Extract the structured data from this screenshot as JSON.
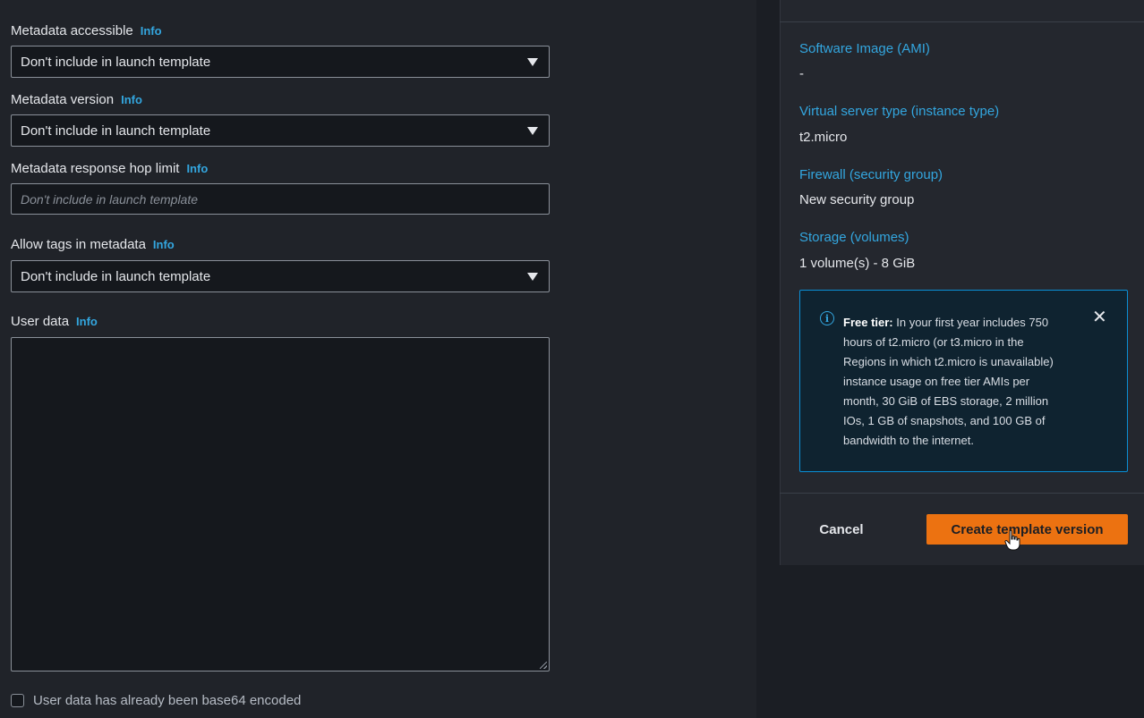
{
  "form": {
    "metadata_accessible": {
      "label": "Metadata accessible",
      "info": "Info",
      "value": "Don't include in launch template"
    },
    "metadata_version": {
      "label": "Metadata version",
      "info": "Info",
      "value": "Don't include in launch template"
    },
    "hop_limit": {
      "label": "Metadata response hop limit",
      "info": "Info",
      "placeholder": "Don't include in launch template"
    },
    "allow_tags": {
      "label": "Allow tags in metadata",
      "info": "Info",
      "value": "Don't include in launch template"
    },
    "user_data": {
      "label": "User data",
      "info": "Info",
      "value": ""
    },
    "base64_checkbox": {
      "label": "User data has already been base64 encoded",
      "checked": false
    }
  },
  "summary": {
    "ami": {
      "label": "Software Image (AMI)",
      "value": "-"
    },
    "instance_type": {
      "label": "Virtual server type (instance type)",
      "value": "t2.micro"
    },
    "firewall": {
      "label": "Firewall (security group)",
      "value": "New security group"
    },
    "storage": {
      "label": "Storage (volumes)",
      "value": "1 volume(s) - 8 GiB"
    },
    "free_tier": {
      "title": "Free tier:",
      "lines": [
        " In your first year includes 750",
        "hours of t2.micro (or t3.micro in the",
        "Regions in which t2.micro is unavailable)",
        "instance usage on free tier AMIs per",
        "month, 30 GiB of EBS storage, 2 million",
        "IOs, 1 GB of snapshots, and 100 GB of",
        "bandwidth to the internet."
      ],
      "close_symbol": "✕",
      "info_symbol": "i"
    },
    "cancel_label": "Cancel",
    "create_label": "Create template version"
  },
  "colors": {
    "accent": "#33a6df",
    "primary_button": "#ec7211",
    "info_border": "#0a8fd6"
  }
}
